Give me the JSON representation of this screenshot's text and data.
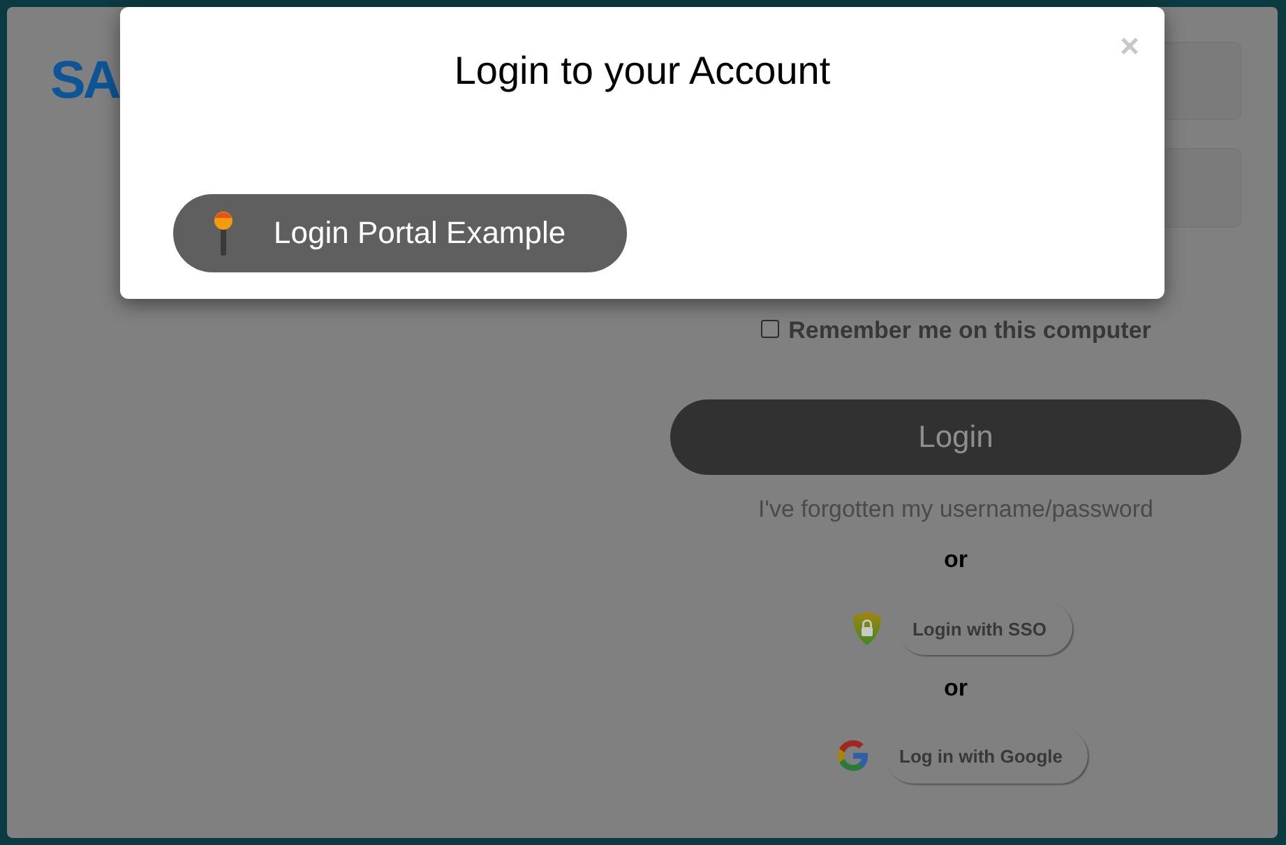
{
  "page": {
    "logo": "SA",
    "remember": {
      "label": "Remember me on this computer",
      "checked": false
    },
    "login_button": "Login",
    "forgot_link": "I've forgotten my username/password",
    "alternatives": [
      {
        "separator": "or",
        "kind": "sso",
        "label": "Login with SSO"
      },
      {
        "separator": "or",
        "kind": "google",
        "label": "Log in with Google"
      }
    ]
  },
  "modal": {
    "title": "Login to your Account",
    "close": "×",
    "portal_button": "Login Portal Example"
  }
}
